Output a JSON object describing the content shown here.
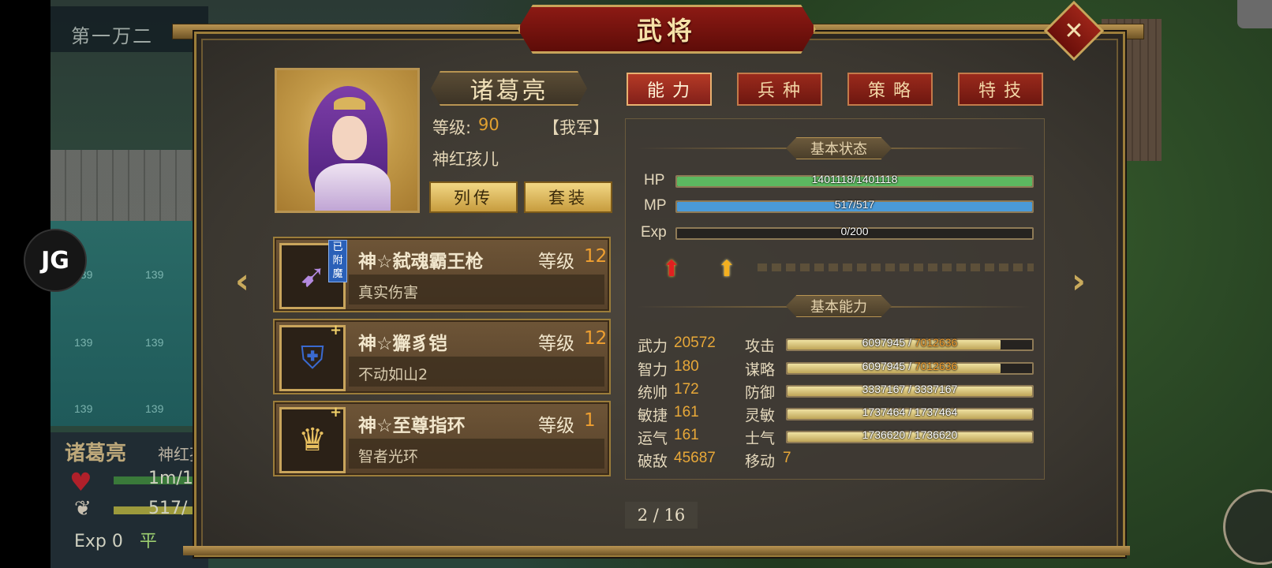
{
  "background": {
    "top_banner": "第一万二",
    "tile_number": "139",
    "status": {
      "name": "诸葛亮",
      "title": "神红孩",
      "hp": "1m/1",
      "mp": "517/",
      "exp": "Exp 0",
      "extra": "平"
    },
    "side_logo": "JG"
  },
  "dialog": {
    "title": "武将",
    "close": "✕",
    "prev_arrow": "‹",
    "next_arrow": "›"
  },
  "hero": {
    "name": "诸葛亮",
    "level_label": "等级:",
    "level": "90",
    "side": "【我军】",
    "title": "神红孩儿",
    "biography_button": "列传",
    "set_button": "套装"
  },
  "equipment": [
    {
      "name": "神☆弑魂霸王枪",
      "level_label": "等级",
      "level": "12",
      "skill": "真实伤害",
      "badge": "已附魔",
      "icon": "spear-icon"
    },
    {
      "name": "神☆獬豸铠",
      "level_label": "等级",
      "level": "12",
      "skill": "不动如山2",
      "icon": "armor-icon"
    },
    {
      "name": "神☆至尊指环",
      "level_label": "等级",
      "level": "1",
      "skill": "智者光环",
      "icon": "ring-icon"
    }
  ],
  "tabs": [
    {
      "label": "能力",
      "active": true
    },
    {
      "label": "兵种",
      "active": false
    },
    {
      "label": "策略",
      "active": false
    },
    {
      "label": "特技",
      "active": false
    }
  ],
  "basic_status": {
    "header": "基本状态",
    "hp": {
      "label": "HP",
      "current": 1401118,
      "max": 1401118,
      "text": "1401118/1401118",
      "color": "#5cb860"
    },
    "mp": {
      "label": "MP",
      "current": 517,
      "max": 517,
      "text": "517/517",
      "color": "#4a9ad8"
    },
    "exp": {
      "label": "Exp",
      "current": 0,
      "max": 200,
      "text": "0/200",
      "color": "#c0a050"
    }
  },
  "basic_ability": {
    "header": "基本能力",
    "attributes": [
      {
        "label": "武力",
        "value": "20572"
      },
      {
        "label": "智力",
        "value": "180"
      },
      {
        "label": "统帅",
        "value": "172"
      },
      {
        "label": "敏捷",
        "value": "161"
      },
      {
        "label": "运气",
        "value": "161"
      },
      {
        "label": "破敌",
        "value": "45687"
      }
    ],
    "combat": [
      {
        "label": "攻击",
        "current": "6097945",
        "sep": " / ",
        "max": "7012636",
        "fill": 0.87,
        "max_highlight": true
      },
      {
        "label": "谋略",
        "current": "6097945",
        "sep": " / ",
        "max": "7012636",
        "fill": 0.87,
        "max_highlight": true
      },
      {
        "label": "防御",
        "current": "3337167",
        "sep": " / ",
        "max": "3337167",
        "fill": 1.0,
        "max_highlight": false
      },
      {
        "label": "灵敏",
        "current": "1737464",
        "sep": " / ",
        "max": "1737464",
        "fill": 1.0,
        "max_highlight": false
      },
      {
        "label": "士气",
        "current": "1736620",
        "sep": " / ",
        "max": "1736620",
        "fill": 1.0,
        "max_highlight": false
      }
    ],
    "move_label": "移动",
    "move_value": "7"
  },
  "page": {
    "text": "2 / 16"
  },
  "colors": {
    "accent_gold": "#c9a55c",
    "tab_red": "#9a2a1c",
    "value_orange": "#e8a838"
  }
}
